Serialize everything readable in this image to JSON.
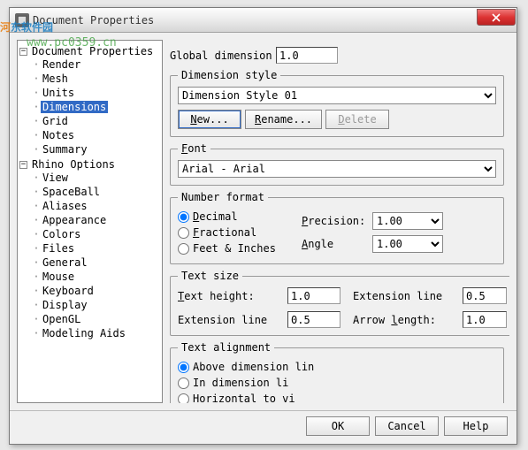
{
  "window": {
    "title": "Document Properties"
  },
  "watermark": {
    "cn1": "河",
    "cn2": "东软件园",
    "url": "www.pc0359.cn"
  },
  "tree": {
    "root1": "Document Properties",
    "root1_items": [
      "Render",
      "Mesh",
      "Units",
      "Dimensions",
      "Grid",
      "Notes",
      "Summary"
    ],
    "root2": "Rhino Options",
    "root2_items": [
      "View",
      "SpaceBall",
      "Aliases",
      "Appearance",
      "Colors",
      "Files",
      "General",
      "Mouse",
      "Keyboard",
      "Display",
      "OpenGL",
      "Modeling Aids"
    ]
  },
  "panel": {
    "global_dim_lbl": "Global dimension",
    "global_dim_val": "1.0",
    "dim_style_legend": "Dimension style",
    "dim_style_selected": "Dimension Style 01",
    "btn_new_pre": "N",
    "btn_new_post": "ew...",
    "btn_ren_pre": "R",
    "btn_ren_post": "ename...",
    "btn_del_pre": "D",
    "btn_del_post": "elete",
    "font_legend": "F",
    "font_legend_post": "ont",
    "font_selected": "Arial - Arial",
    "nf_legend": "Number format",
    "nf_dec_pre": "D",
    "nf_dec_post": "ecimal",
    "nf_frac_pre": "F",
    "nf_frac_post": "ractional",
    "nf_fi": "Feet & Inches",
    "precision_pre": "P",
    "precision_post": "recision:",
    "precision_val": "1.00",
    "angle_pre": "A",
    "angle_post": "ngle",
    "angle_val": "1.00",
    "ts_legend": "Text size",
    "ts_th_pre": "T",
    "ts_th_post": "ext height:",
    "ts_th_val": "1.0",
    "ts_ext1": "Extension line",
    "ts_ext1_val": "0.5",
    "ts_ext2": "Extension line",
    "ts_ext2_val": "0.5",
    "ts_arrow_pre": "Arrow ",
    "ts_arrow_mid": "l",
    "ts_arrow_post": "ength:",
    "ts_arrow_val": "1.0",
    "ta_legend": "Text alignment",
    "ta_above": "Above dimension lin",
    "ta_in": "In dimension li",
    "ta_horiz": "Horizontal to vi"
  },
  "footer": {
    "ok": "OK",
    "cancel": "Cancel",
    "help": "Help"
  }
}
